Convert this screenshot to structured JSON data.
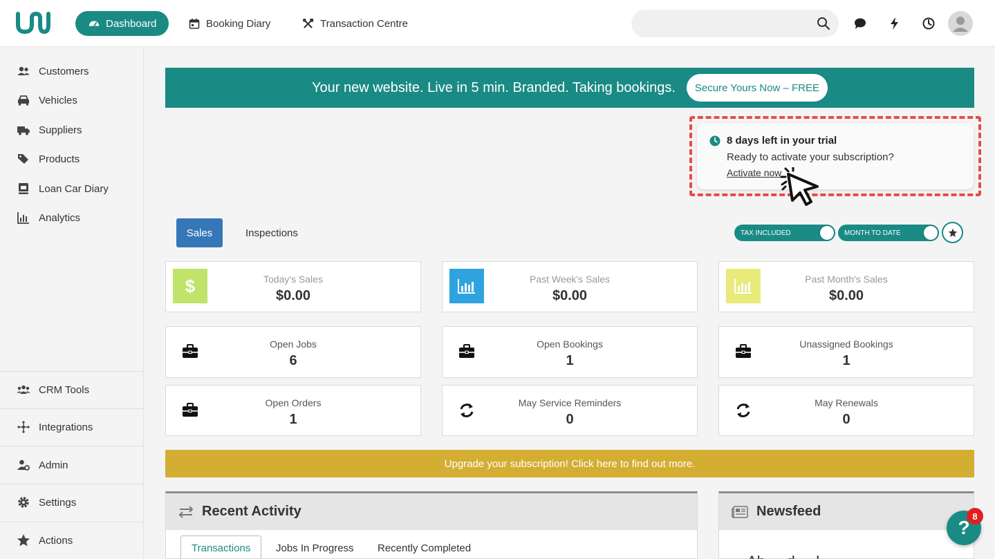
{
  "topbar": {
    "nav": [
      {
        "label": "Dashboard",
        "icon": "gauge-icon"
      },
      {
        "label": "Booking Diary",
        "icon": "calendar-icon"
      },
      {
        "label": "Transaction Centre",
        "icon": "tools-icon"
      }
    ],
    "search_placeholder": ""
  },
  "sidebar": {
    "items": [
      {
        "label": "Customers",
        "icon": "users-icon"
      },
      {
        "label": "Vehicles",
        "icon": "car-icon"
      },
      {
        "label": "Suppliers",
        "icon": "truck-icon"
      },
      {
        "label": "Products",
        "icon": "tags-icon"
      },
      {
        "label": "Loan Car Diary",
        "icon": "book-icon"
      },
      {
        "label": "Analytics",
        "icon": "chart-icon"
      }
    ],
    "bottom_items": [
      {
        "label": "CRM Tools",
        "icon": "people-icon"
      },
      {
        "label": "Integrations",
        "icon": "integrations-icon"
      },
      {
        "label": "Admin",
        "icon": "user-cog-icon"
      },
      {
        "label": "Settings",
        "icon": "gear-icon"
      },
      {
        "label": "Actions",
        "icon": "star-icon"
      }
    ]
  },
  "promo": {
    "text": "Your new website. Live in 5 min. Branded. Taking bookings.",
    "button": "Secure Yours Now – FREE"
  },
  "trial": {
    "title": "8 days left in your trial",
    "subtitle": "Ready to activate your subscription?",
    "link": "Activate now"
  },
  "tabs": {
    "sales": "Sales",
    "inspections": "Inspections"
  },
  "toggles": {
    "tax": "TAX INCLUDED",
    "period": "MONTH TO DATE"
  },
  "sales_cards": [
    {
      "label": "Today's Sales",
      "value": "$0.00",
      "color": "#c0e36a"
    },
    {
      "label": "Past Week's Sales",
      "value": "$0.00",
      "color": "#2fa3e0"
    },
    {
      "label": "Past Month's Sales",
      "value": "$0.00",
      "color": "#e8eb7a"
    }
  ],
  "stat_cards": [
    {
      "label": "Open Jobs",
      "value": "6",
      "icon": "briefcase-icon"
    },
    {
      "label": "Open Bookings",
      "value": "1",
      "icon": "briefcase-icon"
    },
    {
      "label": "Unassigned Bookings",
      "value": "1",
      "icon": "briefcase-icon"
    },
    {
      "label": "Open Orders",
      "value": "1",
      "icon": "briefcase-icon"
    },
    {
      "label": "May Service Reminders",
      "value": "0",
      "icon": "refresh-icon"
    },
    {
      "label": "May Renewals",
      "value": "0",
      "icon": "refresh-icon"
    }
  ],
  "upgrade": "Upgrade your subscription! Click here to find out more.",
  "recent_activity": {
    "title": "Recent Activity",
    "tabs": [
      "Transactions",
      "Jobs In Progress",
      "Recently Completed"
    ]
  },
  "newsfeed": {
    "title": "Newsfeed",
    "preview": "Ah ... d ... l ..."
  },
  "help": {
    "label": "?",
    "badge": "8"
  },
  "colors": {
    "brand": "#1a8a84",
    "primary": "#3577b8",
    "upgrade": "#d3ae32",
    "alert": "#e84b4b"
  }
}
